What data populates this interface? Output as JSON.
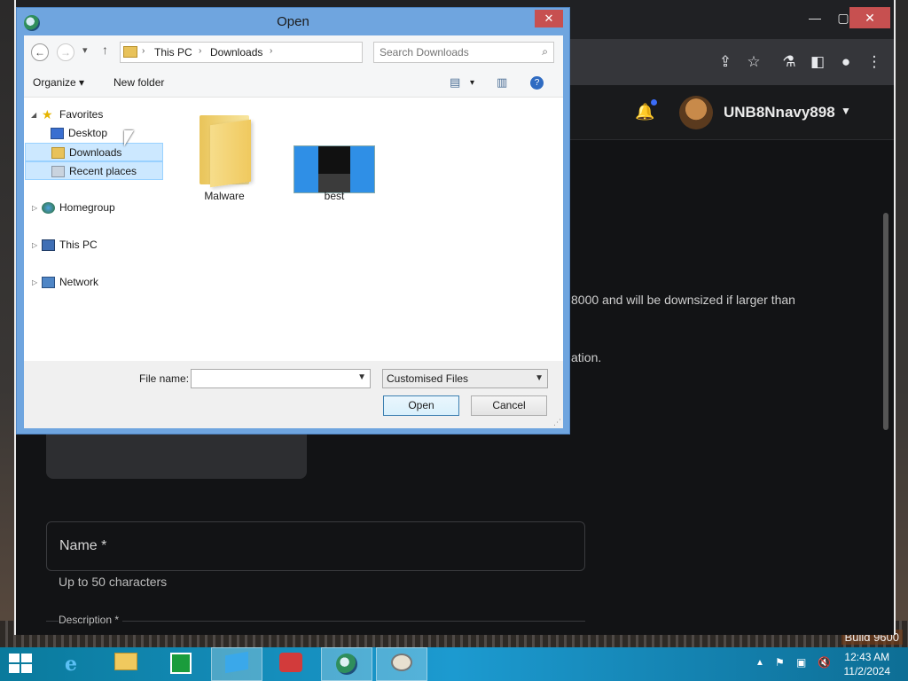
{
  "dialog": {
    "title": "Open",
    "close_label": "✕",
    "breadcrumb": [
      "This PC",
      "Downloads"
    ],
    "search_placeholder": "Search Downloads",
    "organize_label": "Organize ▾",
    "new_folder_label": "New folder",
    "help_label": "?",
    "nav": {
      "favorites": "Favorites",
      "desktop": "Desktop",
      "downloads": "Downloads",
      "recent": "Recent places",
      "homegroup": "Homegroup",
      "this_pc": "This PC",
      "network": "Network"
    },
    "files": [
      {
        "name": "Malware",
        "type": "folder"
      },
      {
        "name": "best",
        "type": "image"
      }
    ],
    "file_name_label": "File name:",
    "file_name_value": "",
    "filter_value": "Customised Files",
    "open_label": "Open",
    "cancel_label": "Cancel"
  },
  "browser": {
    "username": "UNB8Nnavy898",
    "text_line1": "8000 and will be downsized if larger than",
    "text_line2": "ation.",
    "name_field_label": "Name *",
    "name_hint": "Up to 50 characters",
    "description_label": "Description *"
  },
  "taskbar": {
    "time": "12:43 AM",
    "date": "11/2/2024",
    "build": "Build 9600"
  },
  "colors": {
    "dialog_frame": "#6fa5df",
    "taskbar": "#1c9ad0",
    "selection": "#cce8ff",
    "close": "#c75050"
  }
}
